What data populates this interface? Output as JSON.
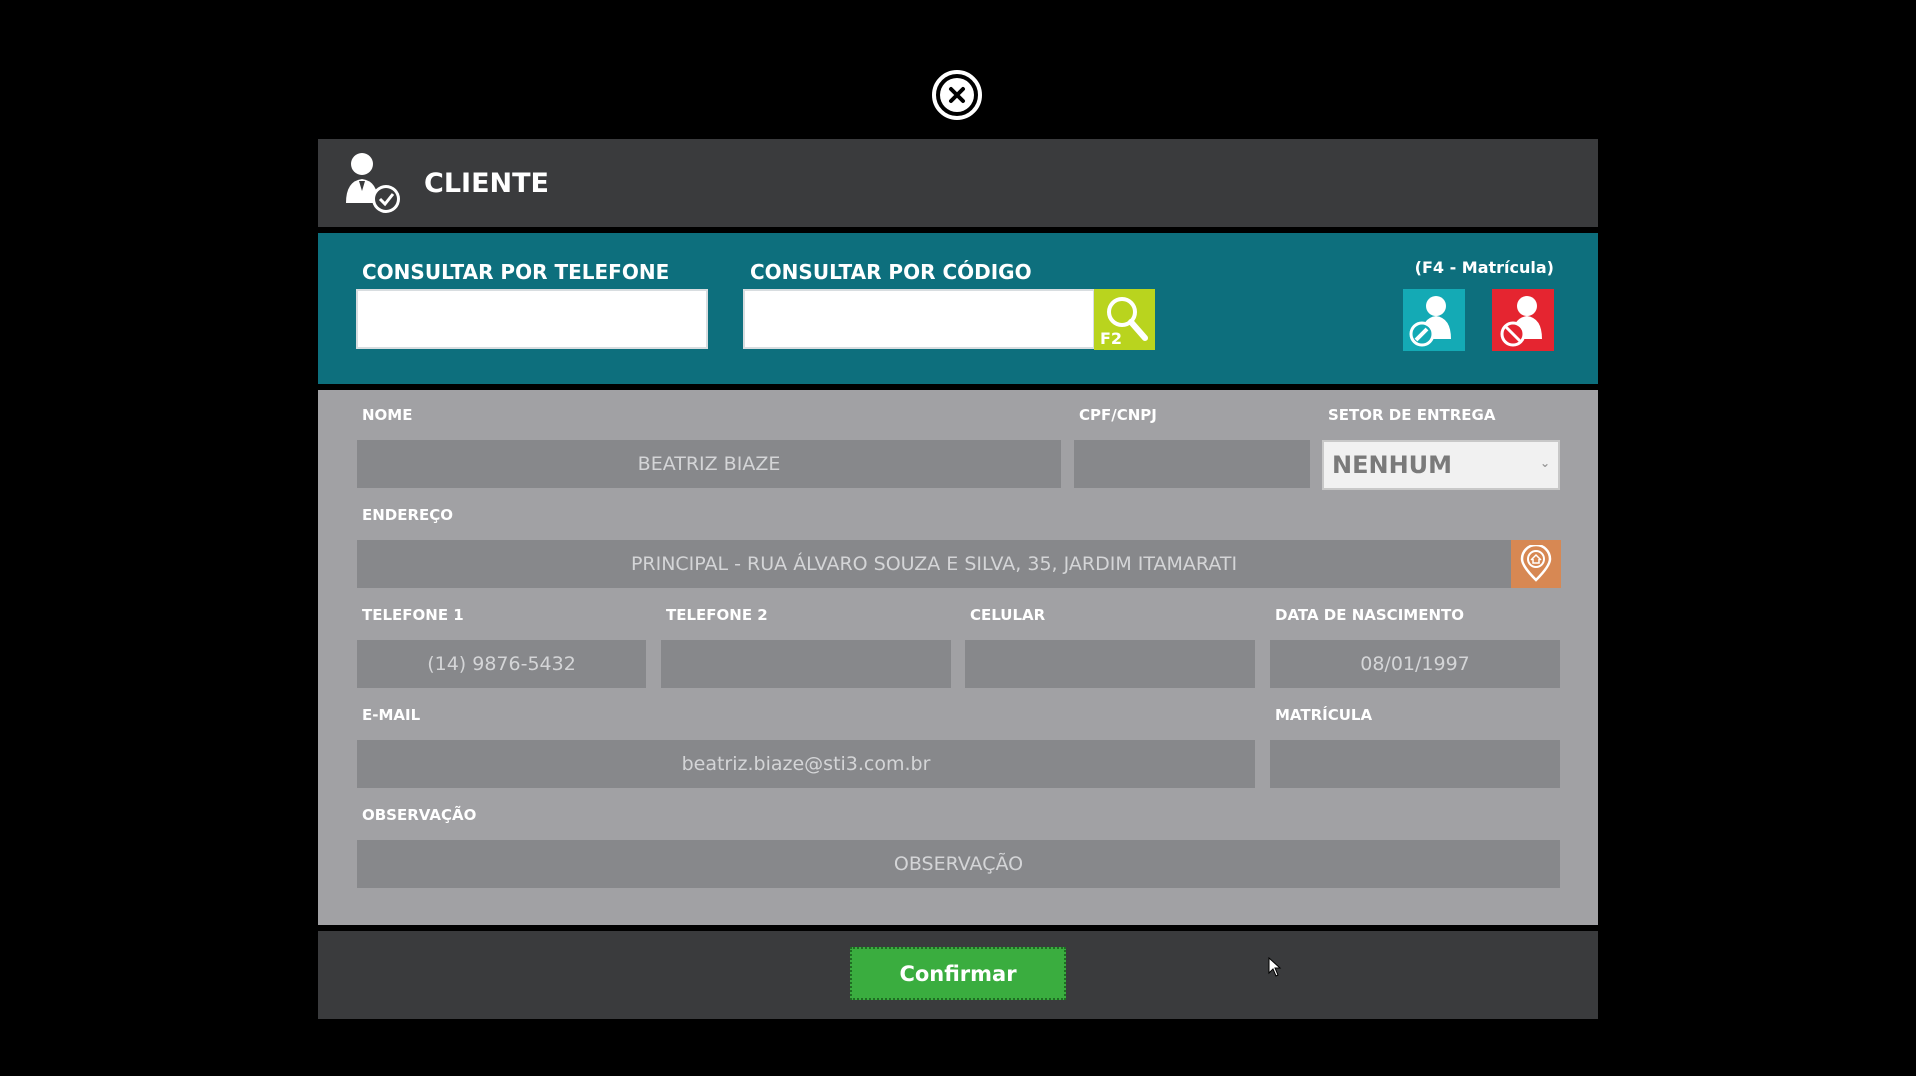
{
  "dialog": {
    "title": "CLIENTE",
    "close_icon": "close-icon"
  },
  "search": {
    "phone_label": "CONSULTAR POR TELEFONE",
    "phone_value": "",
    "code_label": "CONSULTAR POR CÓDIGO",
    "code_value": "",
    "f2_label": "F2",
    "f4_hint": "(F4 - Matrícula)"
  },
  "form": {
    "nome_label": "NOME",
    "nome_value": "BEATRIZ BIAZE",
    "cpf_label": "CPF/CNPJ",
    "cpf_value": "",
    "setor_label": "SETOR DE ENTREGA",
    "setor_value": "NENHUM",
    "endereco_label": "ENDEREÇO",
    "endereco_value": "PRINCIPAL - RUA ÁLVARO SOUZA E SILVA, 35, JARDIM ITAMARATI",
    "tel1_label": "TELEFONE 1",
    "tel1_value": "(14) 9876-5432",
    "tel2_label": "TELEFONE 2",
    "tel2_value": "",
    "celular_label": "CELULAR",
    "celular_value": "",
    "nascimento_label": "DATA DE NASCIMENTO",
    "nascimento_value": "08/01/1997",
    "email_label": "E-MAIL",
    "email_value": "beatriz.biaze@sti3.com.br",
    "matricula_label": "MATRÍCULA",
    "matricula_value": "",
    "obs_label": "OBSERVAÇÃO",
    "obs_placeholder": "OBSERVAÇÃO"
  },
  "footer": {
    "confirm_label": "Confirmar"
  },
  "colors": {
    "search_bg": "#0d6f7d",
    "f2": "#b9d41e",
    "edit": "#14aab5",
    "remove": "#e52530",
    "map": "#d78853",
    "confirm": "#3aad3f"
  }
}
